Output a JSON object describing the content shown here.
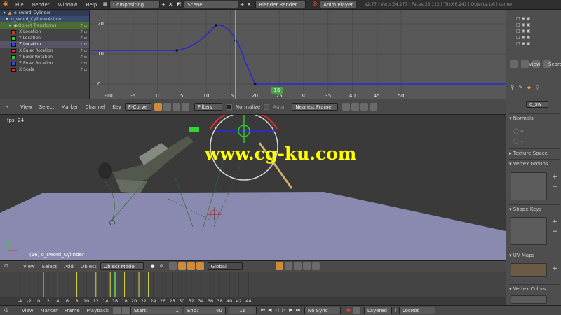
{
  "topbar": {
    "menus": [
      "File",
      "Render",
      "Window",
      "Help"
    ],
    "screen_layout": "Compositing",
    "scene": "Scene",
    "render_engine": "Blender Render",
    "anim_player": "Anim Player",
    "stats": "v2.77 | Verts:34,277 | Faces:33,122 | Tris:66,241 | Objects:1/6 | camera"
  },
  "channels": {
    "object": "o_sword_Cylinder",
    "action": "o_sword_CylinderAction",
    "group": "Object Transforms",
    "items": [
      {
        "label": "X Location",
        "color": "#e23030"
      },
      {
        "label": "Y Location",
        "color": "#30c830"
      },
      {
        "label": "Z Location",
        "color": "#2a4ae0"
      },
      {
        "label": "X Euler Rotation",
        "color": "#e23030"
      },
      {
        "label": "Y Euler Rotation",
        "color": "#30c830"
      },
      {
        "label": "Z Euler Rotation",
        "color": "#2a4ae0"
      },
      {
        "label": "X Scale",
        "color": "#e23030"
      }
    ]
  },
  "graph": {
    "y_ticks": [
      "20",
      "10",
      "0"
    ],
    "x_ticks": [
      "-10",
      "-5",
      "0",
      "5",
      "10",
      "15",
      "20",
      "25",
      "30",
      "35",
      "40",
      "45",
      "50"
    ],
    "current_frame": "16"
  },
  "graph_header": {
    "menus": [
      "View",
      "Select",
      "Marker",
      "Channel",
      "Key"
    ],
    "mode": "F-Curve",
    "filters": "Filters",
    "normalize": "Normalize",
    "auto": "Auto",
    "snap": "Nearest Frame"
  },
  "view3d": {
    "fps": "fps: 24",
    "object_label": "(16) o_sword_Cylinder"
  },
  "watermark": "www.cg-ku.com",
  "view3d_header": {
    "menus": [
      "View",
      "Select",
      "Add",
      "Object"
    ],
    "mode": "Object Mode",
    "orientation": "Global"
  },
  "timeline": {
    "ticks": [
      "-4",
      "-2",
      "0",
      "2",
      "4",
      "6",
      "8",
      "10",
      "12",
      "14",
      "16",
      "18",
      "20",
      "22",
      "24",
      "26",
      "28",
      "30",
      "32",
      "34",
      "36",
      "38",
      "40",
      "42",
      "44"
    ]
  },
  "timeline_header": {
    "menus": [
      "View",
      "Marker",
      "Frame",
      "Playback"
    ],
    "start_label": "Start:",
    "start_value": "1",
    "end_label": "End:",
    "end_value": "40",
    "current": "16",
    "sync": "No Sync",
    "keying_set_a": "Layered",
    "keying_set_b": "LocRot"
  },
  "rpanel": {
    "view_label": "View",
    "search_label": "Searc",
    "object_name": "o_sw",
    "normals": "Normals",
    "texture_space": "Texture Space",
    "vertex_groups": "Vertex Groups",
    "shape_keys": "Shape Keys",
    "uv_maps": "UV Maps",
    "vertex_colors": "Vertex Colors"
  },
  "colors": {
    "curve": "#2a2ad0",
    "frame_line": "#5fd35f",
    "keyframe_line": "#d8d84a"
  }
}
